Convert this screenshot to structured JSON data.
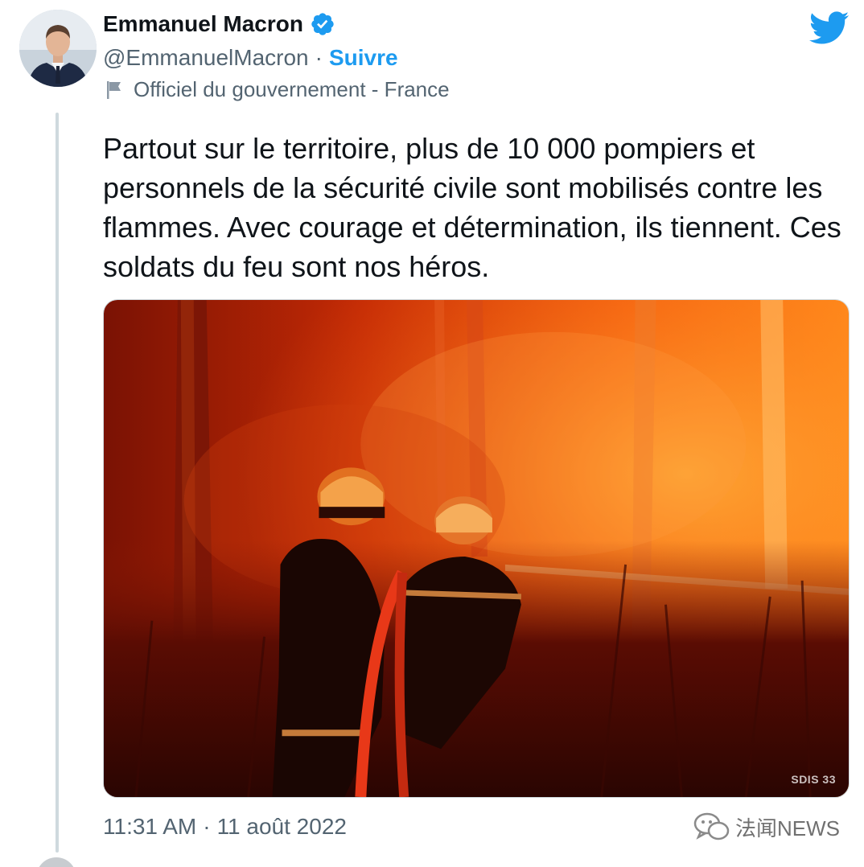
{
  "author": {
    "name": "Emmanuel Macron",
    "handle": "@EmmanuelMacron",
    "separator": "·",
    "follow_label": "Suivre",
    "label_text": "Officiel du gouvernement - France"
  },
  "tweet": {
    "text": "Partout sur le territoire, plus de 10 000 pompiers et personnels de la sécurité civile sont mobilisés contre les flammes. Avec courage et détermination, ils tiennent. Ces soldats du feu sont nos héros.",
    "media_credit": "SDIS 33",
    "time": "11:31 AM",
    "time_separator": "·",
    "date": "11 août 2022"
  },
  "watermark": {
    "text": "法闻NEWS"
  },
  "icons": {
    "verified": "verified-badge-icon",
    "flag": "flag-icon",
    "brand": "twitter-bird-icon",
    "watermark": "wechat-icon"
  },
  "colors": {
    "accent": "#1d9bf0",
    "text": "#0f1419",
    "muted": "#536471",
    "border": "#cfd9de"
  }
}
